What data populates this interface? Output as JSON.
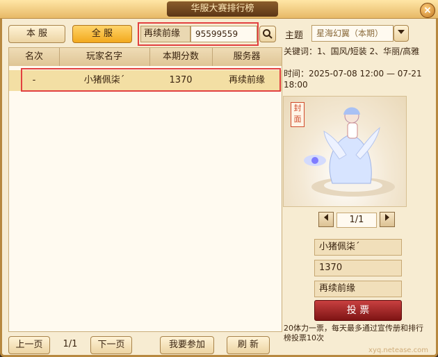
{
  "window": {
    "title": "华服大赛排行榜",
    "close_symbol": "×"
  },
  "toolbar": {
    "server_tab_label": "本 服",
    "all_tab_label": "全 服",
    "search_label": "再续前缘",
    "search_value": "95599559"
  },
  "table": {
    "headers": [
      "名次",
      "玩家名字",
      "本期分数",
      "服务器"
    ],
    "rows": [
      {
        "rank": "-",
        "name": "小猪佩柒´",
        "score": "1370",
        "server": "再续前缘"
      }
    ]
  },
  "pagination": {
    "prev_label": "上一页",
    "page_text": "1/1",
    "next_label": "下一页",
    "join_label": "我要参加",
    "refresh_label": "刷 新"
  },
  "theme": {
    "label": "主题",
    "value": "星海幻翼（本期）",
    "keywords": "关键词：1、国风/短装 2、华丽/高雅",
    "time": "时间：2025-07-08 12:00 — 07-21 18:00"
  },
  "cover": {
    "seal_text": "封面",
    "page_text": "1/1"
  },
  "detail": {
    "name": "小猪佩柒´",
    "score": "1370",
    "server": "再续前缘",
    "vote_label": "投 票",
    "note": "20体力一票，每天最多通过宣传册和排行榜投票10次"
  },
  "watermark": {
    "text": "xyq.netease.com"
  },
  "colors": {
    "accent_gold": "#f2a91d",
    "highlight_red": "#e24040",
    "vote_red": "#c84040"
  }
}
